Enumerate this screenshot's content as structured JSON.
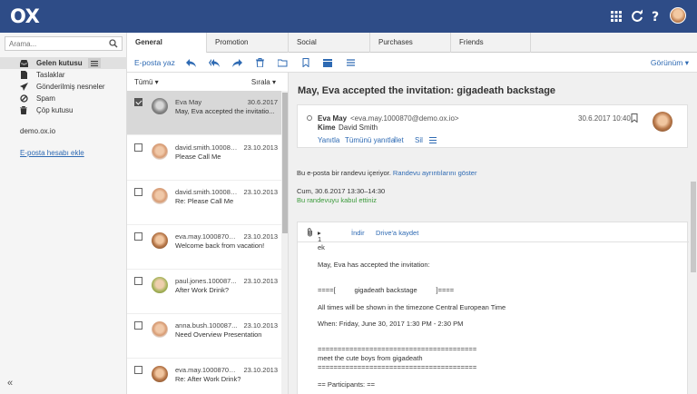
{
  "app": {
    "logo": "OX"
  },
  "topbar": {
    "icons": [
      "apps-grid-icon",
      "refresh-icon",
      "help-icon",
      "user-avatar"
    ]
  },
  "search": {
    "placeholder": "Arama..."
  },
  "folders": [
    {
      "label": "Gelen kutusu",
      "icon": "inbox-icon",
      "active": true
    },
    {
      "label": "Taslaklar",
      "icon": "draft-icon"
    },
    {
      "label": "Gönderilmiş nesneler",
      "icon": "sent-icon"
    },
    {
      "label": "Spam",
      "icon": "spam-icon"
    },
    {
      "label": "Çöp kutusu",
      "icon": "trash-icon"
    }
  ],
  "account": "demo.ox.io",
  "add_account": "E-posta hesabı ekle",
  "tabs": [
    "General",
    "Promotion",
    "Social",
    "Purchases",
    "Friends"
  ],
  "toolbar": {
    "compose": "E-posta yaz",
    "view": "Görünüm"
  },
  "list": {
    "filter": "Tümü",
    "sort": "Sırala",
    "messages": [
      {
        "from": "Eva May",
        "date": "30.6.2017",
        "subject": "May, Eva accepted the invitatio...",
        "selected": true
      },
      {
        "from": "david.smith.100087...",
        "date": "23.10.2013",
        "subject": "Please Call Me"
      },
      {
        "from": "david.smith.100087...",
        "date": "23.10.2013",
        "subject": "Re: Please Call Me"
      },
      {
        "from": "eva.may.1000870@...",
        "date": "23.10.2013",
        "subject": "Welcome back from vacation!"
      },
      {
        "from": "paul.jones.100087...",
        "date": "23.10.2013",
        "subject": "After Work Drink?"
      },
      {
        "from": "anna.bush.100087...",
        "date": "23.10.2013",
        "subject": "Need Overview Presentation"
      },
      {
        "from": "eva.may.1000870@...",
        "date": "23.10.2013",
        "subject": "Re: After Work Drink?"
      }
    ]
  },
  "detail": {
    "title": "May, Eva accepted the invitation: gigadeath backstage",
    "sender": "Eva May",
    "sender_email": "<eva.may.1000870@demo.ox.io>",
    "to_label": "Kime",
    "to": "David Smith",
    "date": "30.6.2017 10:40",
    "actions": [
      "Yanıtla",
      "Tümünü yanıtla",
      "İlet",
      "Sil"
    ],
    "info": "Bu e-posta bir randevu içeriyor.",
    "info_link": "Randevu ayrıntılarını göster",
    "appointment_time": "Cum, 30.6.2017 13:30–14:30",
    "accepted": "Bu randevuyu kabul ettiniz",
    "attachments": "1 ek",
    "download": "İndir",
    "save_drive": "Drive'a kaydet",
    "body": [
      "May, Eva has accepted the invitation:",
      "",
      "====[          gigadeath backstage          ]====",
      "",
      "All times will be shown in the timezone Central European Time",
      "",
      "When: Friday, June 30, 2017 1:30 PM - 2:30 PM",
      "",
      "",
      "========================================",
      "meet the cute boys from gigadeath",
      "========================================",
      "",
      "== Participants: =="
    ]
  },
  "colors": {
    "topbar": "#2e4c87",
    "link": "#2e6ab3",
    "accepted": "#3a9a3a"
  }
}
